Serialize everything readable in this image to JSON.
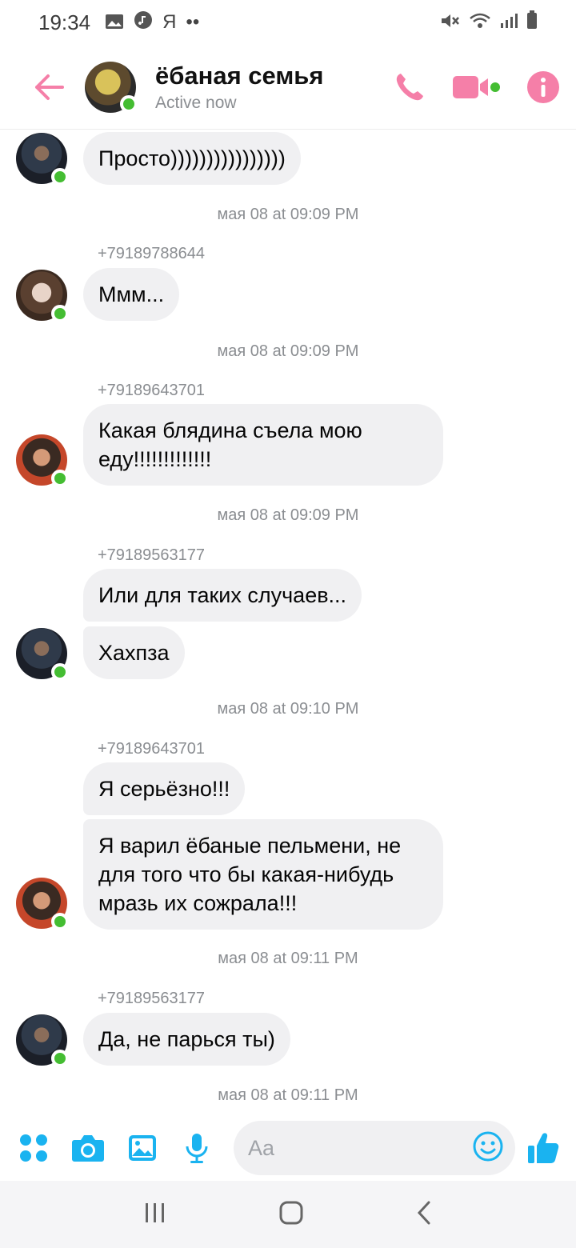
{
  "status_bar": {
    "time": "19:34",
    "letter": "Я",
    "dots": "••",
    "left_icons": [
      "gallery-icon",
      "music-icon"
    ],
    "right_icons": [
      "mute-icon",
      "wifi-icon",
      "signal-icon",
      "battery-icon"
    ]
  },
  "header": {
    "title": "ёбаная семья",
    "subtitle": "Active now",
    "accent_color": "#f57fa8",
    "actions": [
      "phone-icon",
      "video-icon",
      "info-icon"
    ]
  },
  "messages": {
    "m1": "Просто))))))))))))))))",
    "t1": "мая 08 at 09:09 PM",
    "s2": "+79189788644",
    "m2": "Ммм...",
    "t2": "мая 08 at 09:09 PM",
    "s3": "+79189643701",
    "m3": "Какая блядина съела мою еду!!!!!!!!!!!!!",
    "t3": "мая 08 at 09:09 PM",
    "s4": "+79189563177",
    "m4a": "Или для таких случаев...",
    "m4b": "Хахпза",
    "t4": "мая 08 at 09:10 PM",
    "s5": "+79189643701",
    "m5a": "Я серьёзно!!!",
    "m5b": "Я варил ёбаные пельмени, не для того что бы какая-нибудь мразь их сожрала!!!",
    "t5": "мая 08 at 09:11 PM",
    "s6": "+79189563177",
    "m6": "Да, не парься ты)",
    "t6": "мая 08 at 09:11 PM"
  },
  "composer": {
    "placeholder": "Aa",
    "accent_color": "#1ab3f0",
    "icons": [
      "apps-icon",
      "camera-icon",
      "image-icon",
      "mic-icon",
      "emoji-icon",
      "like-icon"
    ]
  },
  "nav_bar": {
    "buttons": [
      "recents-icon",
      "home-icon",
      "back-nav-icon"
    ]
  }
}
